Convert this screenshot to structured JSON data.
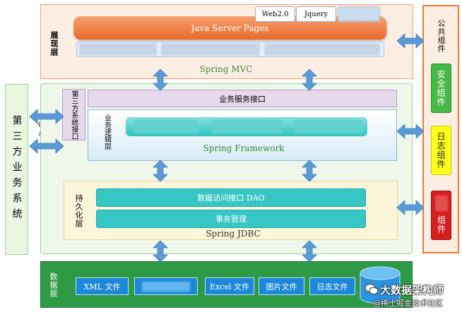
{
  "presentation": {
    "label": "展现层",
    "jsp": "Java Server Pages",
    "web20": "Web2.0",
    "jquery": "Jquery",
    "mvc": "Spring MVC"
  },
  "third_party": {
    "label": "第三方业务系统",
    "soa": "SOA"
  },
  "third_party_interface": "第三方系统接口",
  "business_interface": "业务服务接口",
  "logic": {
    "label": "业务逻辑层",
    "framework": "Spring Framework"
  },
  "persistence": {
    "label": "持久化层",
    "dao": "数据访问接口 DAO",
    "tx": "事务管理",
    "jdbc": "Spring JDBC"
  },
  "data_layer": {
    "label": "数据层",
    "files": [
      "XML 文件",
      "Excel 文件",
      "图片文件",
      "日志文件"
    ]
  },
  "common": {
    "label": "公共组件",
    "security": "安全组件",
    "log": "日志组件",
    "red": "组件"
  },
  "watermark": {
    "name": "大数据架构师",
    "source": "@稀土掘金技术社区"
  },
  "colors": {
    "orange": "#f07a2e",
    "green_border": "#9bd38c",
    "teal": "#39c9c7",
    "blue": "#1e88d8",
    "arrow": "#5b9bd5"
  }
}
